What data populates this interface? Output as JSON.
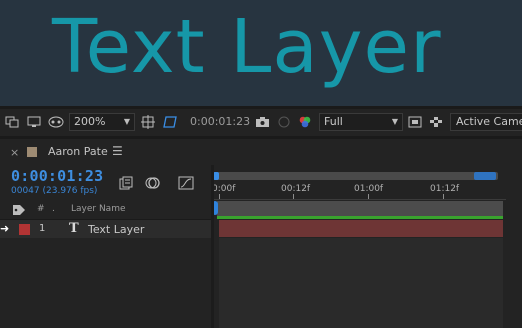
{
  "viewer": {
    "text": "Text Layer"
  },
  "toolbar": {
    "zoom": "200%",
    "timecode": "0:00:01:23",
    "resolution": "Full",
    "camera": "Active Camera"
  },
  "panel": {
    "comp_name": "Aaron Pate",
    "close": "×",
    "menu": "☰"
  },
  "timeline": {
    "timecode": "0:00:01:23",
    "frames": "00047 (23.976 fps)",
    "ruler": [
      "0:00f",
      "00:12f",
      "01:00f",
      "01:12f"
    ],
    "columns": {
      "num": "#",
      "layer_name": "Layer Name"
    }
  },
  "layers": [
    {
      "num": "1",
      "type_glyph": "T",
      "name": "Text Layer",
      "label_color": "#b23434"
    }
  ],
  "colors": {
    "accent": "#3e8ee0",
    "viewer_text": "#1697a8",
    "work_area": "#39a32e",
    "layer_bar": "#6e3535"
  }
}
